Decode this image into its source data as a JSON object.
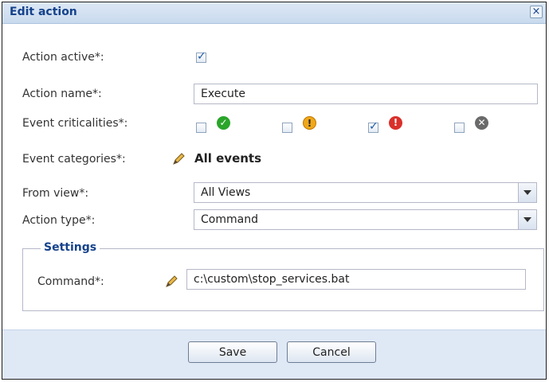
{
  "dialog": {
    "title": "Edit action",
    "close_glyph": "×"
  },
  "form": {
    "action_active": {
      "label": "Action active*:",
      "checked": true
    },
    "action_name": {
      "label": "Action name*:",
      "value": "Execute"
    },
    "event_criticalities": {
      "label": "Event criticalities*:",
      "options": [
        {
          "icon": "success-icon",
          "checked": false,
          "color": "#2aa52a"
        },
        {
          "icon": "warning-icon",
          "checked": false,
          "color": "#f0a81a"
        },
        {
          "icon": "critical-icon",
          "checked": true,
          "color": "#d9302b"
        },
        {
          "icon": "cancel-icon",
          "checked": false,
          "color": "#6a6a6a"
        }
      ]
    },
    "event_categories": {
      "label": "Event categories*:",
      "value": "All events"
    },
    "from_view": {
      "label": "From view*:",
      "value": "All Views"
    },
    "action_type": {
      "label": "Action type*:",
      "value": "Command"
    },
    "settings": {
      "legend": "Settings",
      "command": {
        "label": "Command*:",
        "value": "c:\\custom\\stop_services.bat"
      }
    }
  },
  "buttons": {
    "save": "Save",
    "cancel": "Cancel"
  },
  "colors": {
    "title_text": "#15428b",
    "footer_bg": "#dfe8f5"
  }
}
